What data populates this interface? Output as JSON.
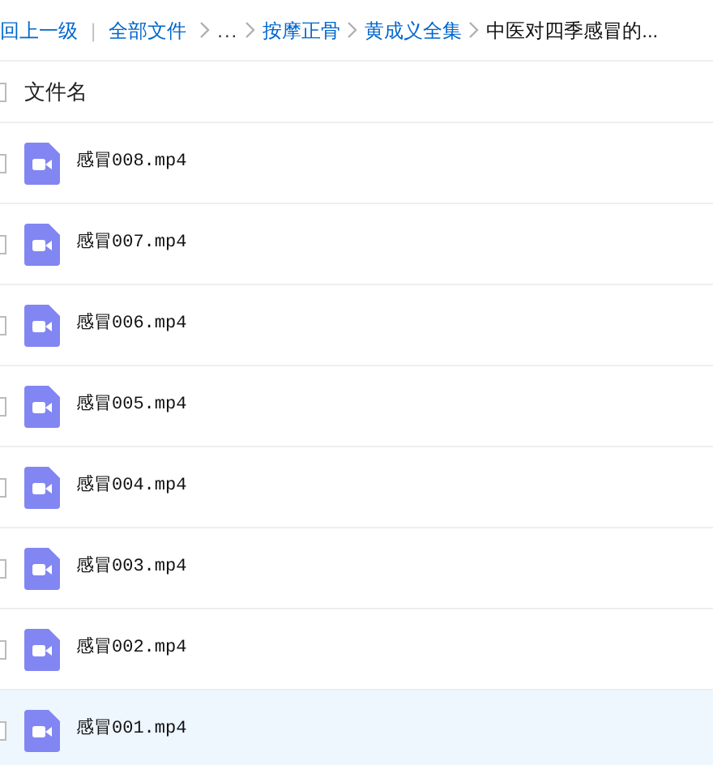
{
  "breadcrumb": {
    "back": "回上一级",
    "separator": "|",
    "items": [
      {
        "kind": "link",
        "label": "全部文件"
      },
      {
        "kind": "ellipsis",
        "label": "..."
      },
      {
        "kind": "link",
        "label": "按摩正骨"
      },
      {
        "kind": "link",
        "label": "黄成义全集"
      },
      {
        "kind": "current",
        "label": "中医对四季感冒的..."
      }
    ]
  },
  "table": {
    "select_all": {
      "checked": false
    },
    "columns": [
      {
        "label": "文件名"
      }
    ],
    "rows": [
      {
        "name": "感冒008.mp4",
        "checked": false,
        "selected": false
      },
      {
        "name": "感冒007.mp4",
        "checked": false,
        "selected": false
      },
      {
        "name": "感冒006.mp4",
        "checked": false,
        "selected": false
      },
      {
        "name": "感冒005.mp4",
        "checked": false,
        "selected": false
      },
      {
        "name": "感冒004.mp4",
        "checked": false,
        "selected": false
      },
      {
        "name": "感冒003.mp4",
        "checked": false,
        "selected": false
      },
      {
        "name": "感冒002.mp4",
        "checked": false,
        "selected": false
      },
      {
        "name": "感冒001.mp4",
        "checked": false,
        "selected": true
      }
    ]
  }
}
